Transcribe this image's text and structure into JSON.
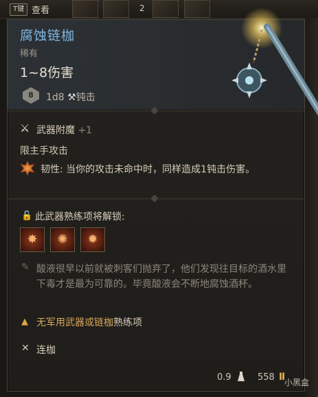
{
  "topbar": {
    "key_label": "T键",
    "view_label": "查看",
    "slot_count": "2"
  },
  "item": {
    "name": "腐蚀链枷",
    "rarity": "稀有",
    "damage": "1~8伤害",
    "dice_value": "8",
    "damage_detail": "1d8",
    "damage_type": "钝击",
    "accent_color": "#7fb6e0"
  },
  "enchant": {
    "label": "武器附魔",
    "bonus": "+1"
  },
  "restriction": "限主手攻击",
  "toughness": {
    "name": "韧性",
    "desc": ": 当你的攻击未命中时，同样造成1钝击伤害。"
  },
  "proficiency": {
    "title": "此武器熟练项将解锁:",
    "icons": [
      "proficiency-action-1-icon",
      "proficiency-action-2-icon",
      "proficiency-action-3-icon"
    ]
  },
  "lore": "酸液很早以前就被刺客们抛弃了，他们发现往目标的酒水里下毒才是最为可靠的。毕竟酸液会不断地腐蚀酒杯。",
  "warning": {
    "part1": "无军用武器或链枷",
    "part2": "熟练项",
    "color": "#d8a85a"
  },
  "special": "连枷",
  "footer": {
    "weight": "0.9",
    "price": "558"
  },
  "watermark": "小黑盒"
}
